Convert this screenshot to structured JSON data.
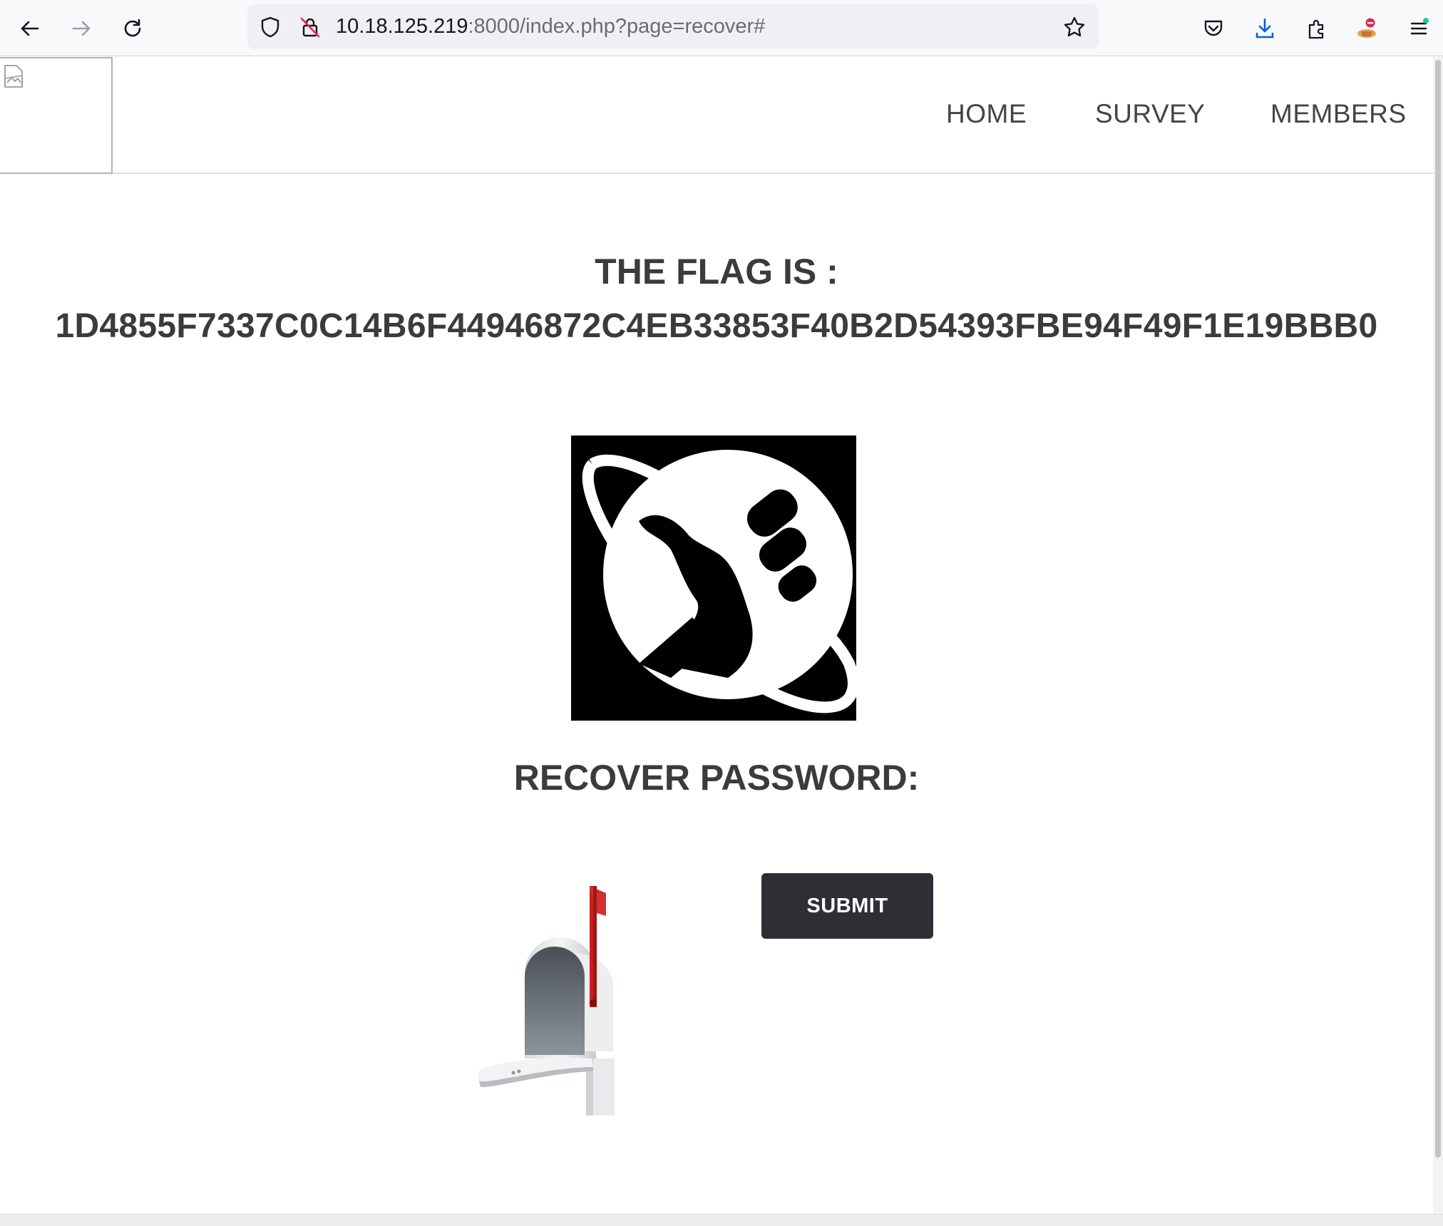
{
  "browser": {
    "url_host": "10.18.125.219",
    "url_rest": ":8000/index.php?page=recover#",
    "icons": [
      "back-arrow-icon",
      "forward-arrow-icon",
      "reload-icon",
      "shield-icon",
      "insecure-lock-icon",
      "bookmark-star-icon",
      "pocket-icon",
      "download-icon",
      "extensions-icon",
      "profile-icon",
      "menu-icon"
    ]
  },
  "nav": {
    "home": "HOME",
    "survey": "SURVEY",
    "members": "MEMBERS"
  },
  "flag": {
    "title": "THE FLAG IS :",
    "value": "1D4855F7337C0C14B6F44946872C4EB33853F40B2D54393FBE94F49F1E19BBB0"
  },
  "recover": {
    "title": "RECOVER PASSWORD:",
    "submit_label": "SUBMIT"
  },
  "colors": {
    "heading": "#3b3b3b",
    "button_bg": "#2f2e34",
    "download_blue": "#0061e0",
    "mailbox_flag_red": "#c8201e"
  }
}
